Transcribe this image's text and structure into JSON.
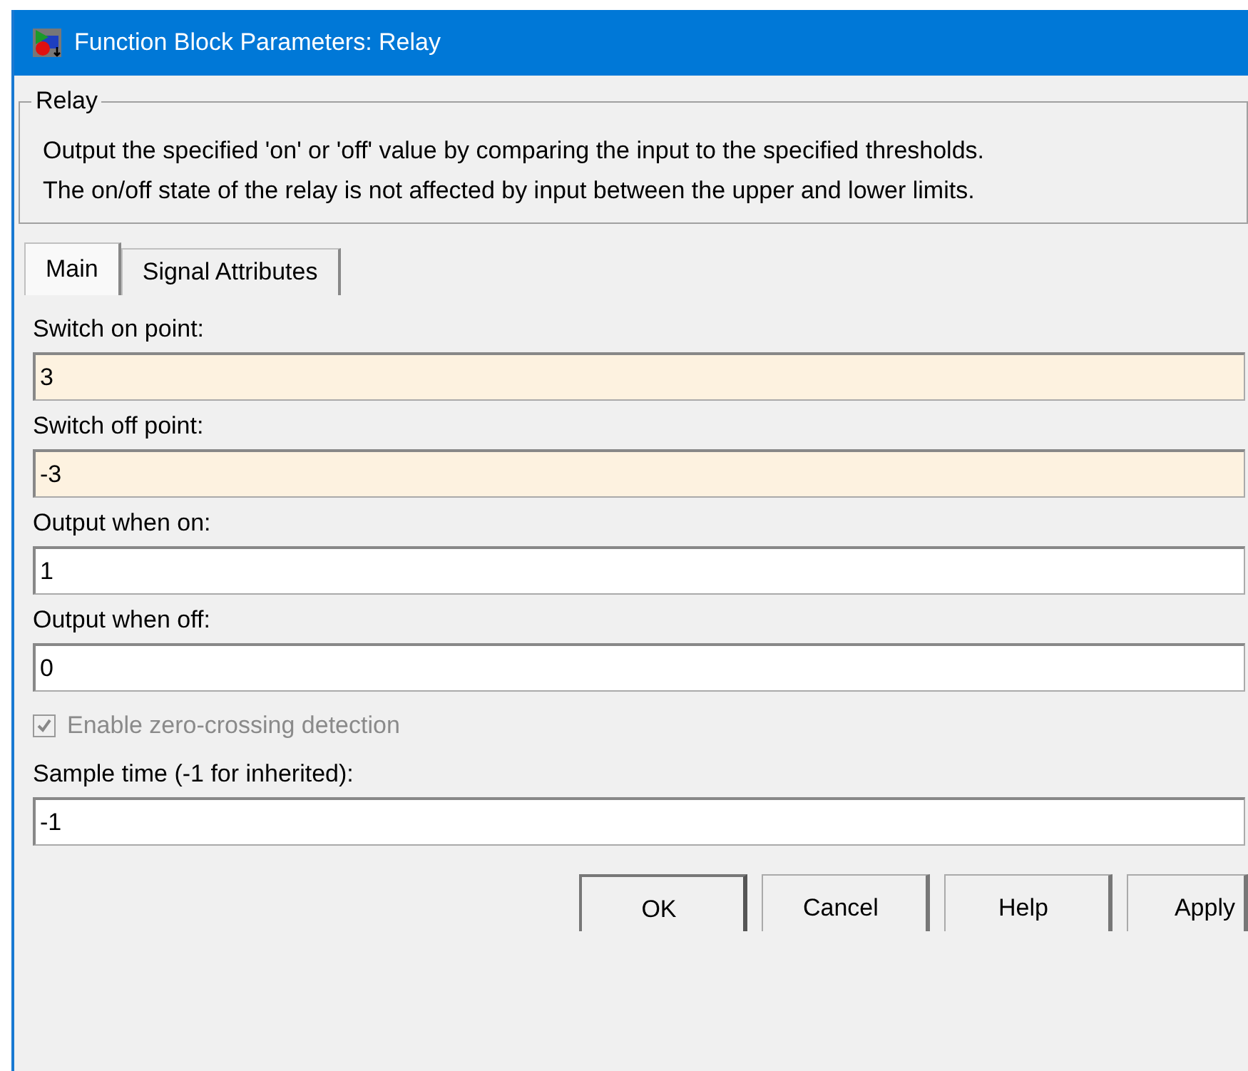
{
  "window": {
    "title": "Function Block Parameters: Relay"
  },
  "group": {
    "title": "Relay",
    "description": [
      "Output the specified 'on' or 'off' value by comparing the input to the specified thresholds.",
      "The on/off state of the relay is not affected by input between the upper and lower limits."
    ]
  },
  "tabs": [
    {
      "label": "Main",
      "selected": true
    },
    {
      "label": "Signal Attributes",
      "selected": false
    }
  ],
  "parameters": [
    {
      "kind": "field",
      "label": "Switch on point:",
      "value": "3",
      "highlighted": true
    },
    {
      "kind": "field",
      "label": "Switch off point:",
      "value": "-3",
      "highlighted": true
    },
    {
      "kind": "field",
      "label": "Output when on:",
      "value": "1",
      "highlighted": false
    },
    {
      "kind": "field",
      "label": "Output when off:",
      "value": "0",
      "highlighted": false
    },
    {
      "kind": "checkbox",
      "label": "Enable zero-crossing detection",
      "checked": true,
      "disabled": true
    },
    {
      "kind": "field",
      "label": "Sample time (-1 for inherited):",
      "value": "-1",
      "highlighted": false
    }
  ],
  "buttons": [
    {
      "label": "OK",
      "default": true
    },
    {
      "label": "Cancel",
      "default": false
    },
    {
      "label": "Help",
      "default": false
    },
    {
      "label": "Apply",
      "default": false
    }
  ]
}
